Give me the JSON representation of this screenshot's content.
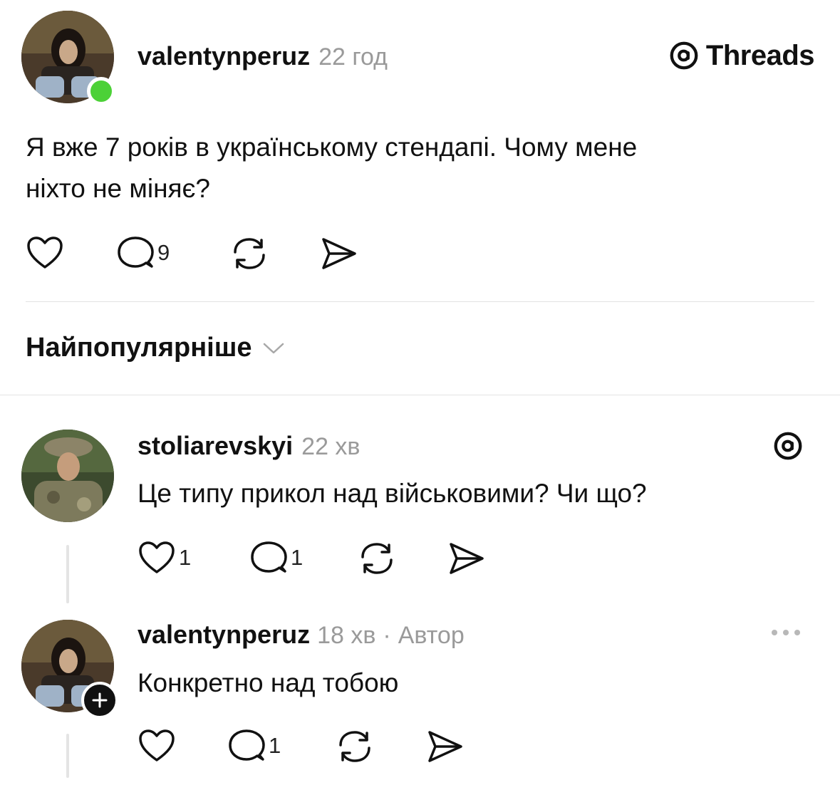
{
  "brand": {
    "label": "Threads",
    "icon": "threads-logo-icon"
  },
  "post": {
    "username": "valentynperuz",
    "time": "22 год",
    "status": "online",
    "status_color": "#4cd137",
    "text_line1": "Я вже 7 років в українському стендапі. Чому мене",
    "text_line2": "ніхто не міняє?",
    "actions": {
      "likes": "",
      "replies": "9",
      "reposts": "",
      "shares": ""
    }
  },
  "sort": {
    "label": "Найпопулярніше",
    "icon": "chevron-down-icon"
  },
  "replies": [
    {
      "username": "stoliarevskyi",
      "time": "22 хв",
      "badge_icon": "threads-logo-icon",
      "text": "Це типу прикол над військовими? Чи що?",
      "likes": "1",
      "replies": "1"
    },
    {
      "username": "valentynperuz",
      "time": "18 хв",
      "separator": "·",
      "role": "Автор",
      "text": "Конкретно над тобою",
      "likes": "",
      "replies": "1",
      "more_icon": "more-dots-icon",
      "follow_icon": "plus-icon"
    }
  ],
  "colors": {
    "text": "#111111",
    "muted": "#9a9a9a",
    "divider": "#e3e3e3"
  }
}
